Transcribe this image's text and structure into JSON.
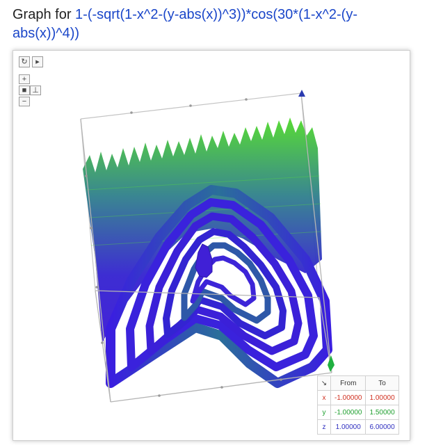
{
  "title": {
    "prefix": "Graph for ",
    "formula": "1-(-sqrt(1-x^2-(y-abs(x))^3))*cos(30*(1-x^2-(y-abs(x))^4))"
  },
  "controls": {
    "reset_icon": "refresh-icon",
    "play_icon": "play-icon",
    "zoom_in_label": "+",
    "zoom_out_label": "−",
    "camera_icon": "camera-icon",
    "axes_icon": "axes-icon"
  },
  "range_table": {
    "corner_icon": "arrow-icon",
    "headers": [
      "From",
      "To"
    ],
    "rows": [
      {
        "axis": "x",
        "from": "-1.00000",
        "to": "1.00000",
        "color": "#d03020"
      },
      {
        "axis": "y",
        "from": "-1.00000",
        "to": "1.50000",
        "color": "#20a030"
      },
      {
        "axis": "z",
        "from": "1.00000",
        "to": "6.00000",
        "color": "#3030c0"
      }
    ]
  },
  "colors": {
    "surface_low": "#3a17d6",
    "surface_mid": "#2f7f8c",
    "surface_high": "#4fd92a",
    "box_line": "#b4b4b4"
  }
}
